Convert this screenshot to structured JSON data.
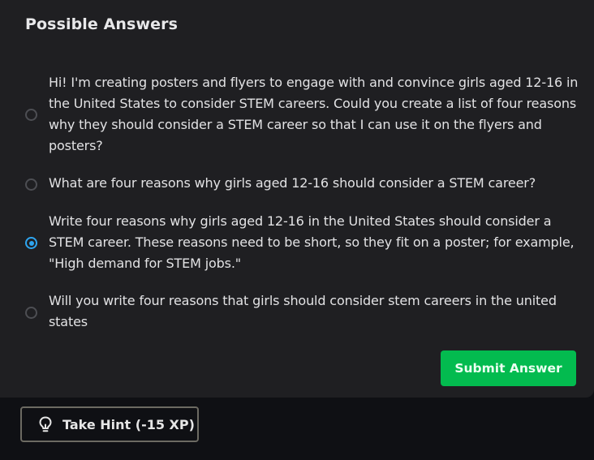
{
  "panel": {
    "title": "Possible Answers"
  },
  "answers": [
    {
      "text": "Hi! I'm creating posters and flyers to engage with and convince girls aged 12-16 in the United States to consider STEM careers. Could you create a list of four reasons why they should consider a STEM career so that I can use it on the flyers and posters?",
      "selected": false
    },
    {
      "text": "What are four reasons why girls aged 12-16 should consider a STEM career?",
      "selected": false
    },
    {
      "text": "Write four reasons why girls aged 12-16 in the United States should consider a STEM career. These reasons need to be short, so they fit on a poster; for example, \"High demand for STEM jobs.\"",
      "selected": true
    },
    {
      "text": "Will you write four reasons that girls should consider stem careers in the united states",
      "selected": false
    }
  ],
  "actions": {
    "submit_label": "Submit Answer",
    "hint_label": "Take Hint (-15 XP)",
    "hint_icon": "lightbulb-icon"
  },
  "colors": {
    "panel_bg": "#1f1f22",
    "page_bg": "#0f1014",
    "accent_green": "#03bb4f",
    "radio_selected": "#2ea5f0"
  }
}
